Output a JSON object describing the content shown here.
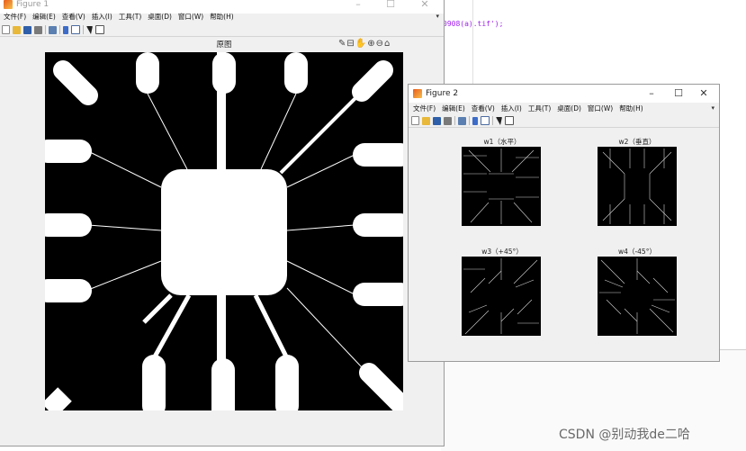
{
  "editor": {
    "code_fragment": "0908(a).tif');"
  },
  "figure1": {
    "title": "Figure 1",
    "menus": [
      "文件(F)",
      "编辑(E)",
      "查看(V)",
      "插入(I)",
      "工具(T)",
      "桌面(D)",
      "窗口(W)",
      "帮助(H)"
    ],
    "axes_title": "原图",
    "controls": {
      "minimize": "–",
      "maximize": "☐",
      "close": "✕"
    }
  },
  "figure2": {
    "title": "Figure 2",
    "menus": [
      "文件(F)",
      "编辑(E)",
      "查看(V)",
      "插入(I)",
      "工具(T)",
      "桌面(D)",
      "窗口(W)",
      "帮助(H)"
    ],
    "subplots": [
      {
        "title": "w1（水平）"
      },
      {
        "title": "w2（垂直）"
      },
      {
        "title": "w3（+45°）"
      },
      {
        "title": "w4（-45°）"
      }
    ],
    "controls": {
      "minimize": "–",
      "maximize": "☐",
      "close": "✕"
    }
  },
  "icons": {
    "menu_overflow": "▾",
    "axes_tools": [
      "brush-icon",
      "data-tip-icon",
      "pan-icon",
      "zoom-in-icon",
      "zoom-out-icon",
      "home-icon"
    ]
  },
  "watermark": "CSDN @别动我de二哈"
}
